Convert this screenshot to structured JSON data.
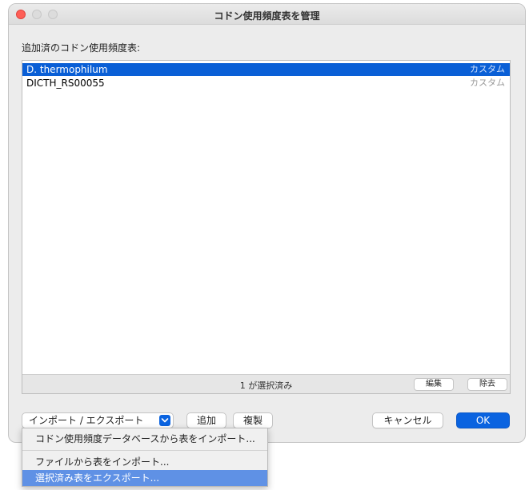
{
  "window": {
    "title": "コドン使用頻度表を管理"
  },
  "list": {
    "label": "追加済のコドン使用頻度表:",
    "rows": [
      {
        "name": "D. thermophilum",
        "kind": "カスタム",
        "selected": true
      },
      {
        "name": "DICTH_RS00055",
        "kind": "カスタム",
        "selected": false
      }
    ],
    "status": "1 が選択済み",
    "edit_label": "編集",
    "remove_label": "除去"
  },
  "buttons": {
    "import_export_label": "インポート / エクスポート",
    "add_label": "追加",
    "duplicate_label": "複製",
    "cancel_label": "キャンセル",
    "ok_label": "OK"
  },
  "menu": {
    "items": [
      {
        "label": "コドン使用頻度データベースから表をインポート..."
      },
      {
        "label": "ファイルから表をインポート..."
      },
      {
        "label": "選択済み表をエクスポート...",
        "highlighted": true
      }
    ]
  },
  "colors": {
    "accent": "#0a63e0",
    "selection": "#0a5fd6",
    "menu_highlight": "#5f91e5",
    "close": "#fe5f57"
  }
}
